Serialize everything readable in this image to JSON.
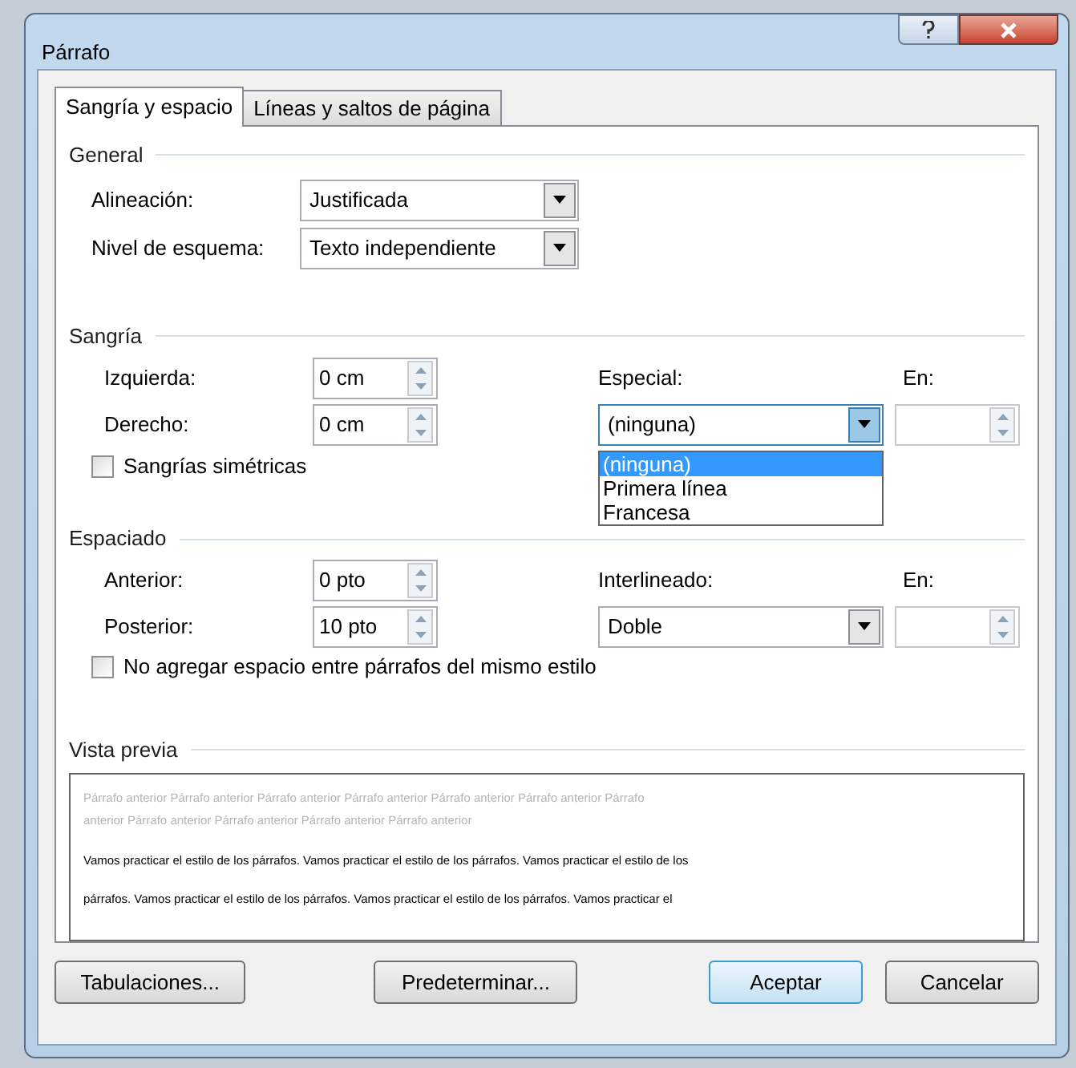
{
  "window": {
    "title": "Párrafo"
  },
  "tabs": [
    {
      "label": "Sangría y espacio",
      "selected": true
    },
    {
      "label": "Líneas y saltos de página",
      "selected": false
    }
  ],
  "general": {
    "heading": "General",
    "fields": [
      {
        "label": "Alineación:",
        "value": "Justificada"
      },
      {
        "label": "Nivel de esquema:",
        "value": "Texto independiente"
      }
    ]
  },
  "indentation": {
    "heading": "Sangría",
    "spins": [
      {
        "label": "Izquierda:",
        "value": "0 cm"
      },
      {
        "label": "Derecho:",
        "value": "0 cm"
      }
    ],
    "special": {
      "label": "Especial:",
      "value": "(ninguna)",
      "expanded": true,
      "options": [
        {
          "label": "(ninguna)",
          "selected": true
        },
        {
          "label": "Primera línea",
          "selected": false
        },
        {
          "label": "Francesa",
          "selected": false
        }
      ]
    },
    "by": {
      "label": "En:"
    },
    "checkbox": {
      "label": "Sangrías simétricas",
      "checked": false
    }
  },
  "spacing": {
    "heading": "Espaciado",
    "spins": [
      {
        "label": "Anterior:",
        "value": "0 pto"
      },
      {
        "label": "Posterior:",
        "value": "10 pto"
      }
    ],
    "line_spacing": {
      "label": "Interlineado:",
      "value": "Doble",
      "expanded": false
    },
    "by": {
      "label": "En:"
    },
    "checkbox": {
      "label": "No agregar espacio entre párrafos del mismo estilo",
      "checked": false
    }
  },
  "preview": {
    "heading": "Vista previa",
    "previous_lines": [
      "Párrafo anterior Párrafo anterior Párrafo anterior Párrafo anterior Párrafo anterior Párrafo anterior Párrafo",
      "anterior Párrafo anterior Párrafo anterior Párrafo anterior Párrafo anterior"
    ],
    "sample_lines": [
      "Vamos practicar el estilo de los párrafos. Vamos practicar el estilo de los párrafos. Vamos practicar el estilo de los",
      "párrafos. Vamos practicar el estilo de los párrafos. Vamos practicar el estilo de los párrafos. Vamos practicar el"
    ]
  },
  "buttons": [
    {
      "label": "Tabulaciones...",
      "default": false
    },
    {
      "label": "Predeterminar...",
      "default": false
    },
    {
      "label": "Aceptar",
      "default": true
    },
    {
      "label": "Cancelar",
      "default": false
    }
  ]
}
